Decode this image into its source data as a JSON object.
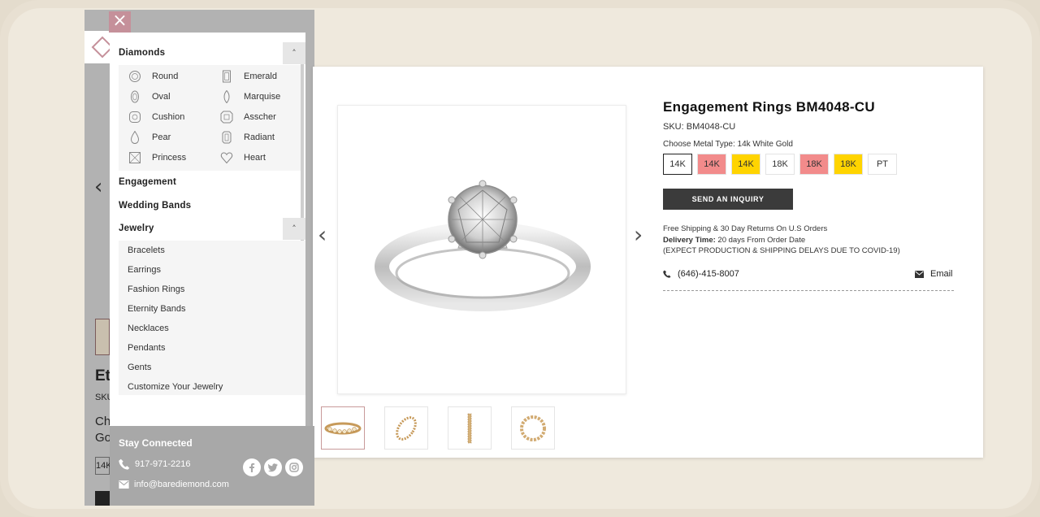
{
  "menu": {
    "close_label": "×",
    "diamonds": {
      "label": "Diamonds",
      "collapse_glyph": "˄",
      "shapes": [
        {
          "label": "Round",
          "icon": "round-diamond-icon"
        },
        {
          "label": "Emerald",
          "icon": "emerald-diamond-icon"
        },
        {
          "label": "Oval",
          "icon": "oval-diamond-icon"
        },
        {
          "label": "Marquise",
          "icon": "marquise-diamond-icon"
        },
        {
          "label": "Cushion",
          "icon": "cushion-diamond-icon"
        },
        {
          "label": "Asscher",
          "icon": "asscher-diamond-icon"
        },
        {
          "label": "Pear",
          "icon": "pear-diamond-icon"
        },
        {
          "label": "Radiant",
          "icon": "radiant-diamond-icon"
        },
        {
          "label": "Princess",
          "icon": "princess-diamond-icon"
        },
        {
          "label": "Heart",
          "icon": "heart-diamond-icon"
        }
      ]
    },
    "engagement": "Engagement",
    "wedding_bands": "Wedding Bands",
    "jewelry": {
      "label": "Jewelry",
      "collapse_glyph": "˄",
      "items": [
        "Bracelets",
        "Earrings",
        "Fashion Rings",
        "Eternity Bands",
        "Necklaces",
        "Pendants",
        "Gents",
        "Customize Your Jewelry"
      ]
    },
    "stay_connected": {
      "title": "Stay Connected",
      "phone": "917-971-2216",
      "email": "info@barediemond.com",
      "social": [
        "facebook-icon",
        "twitter-icon",
        "instagram-icon"
      ]
    }
  },
  "background_page": {
    "text_lines": [
      "Et",
      "SKU",
      "Ch",
      "Go",
      "14K"
    ]
  },
  "product": {
    "title": "Engagement Rings BM4048-CU",
    "sku": "SKU: BM4048-CU",
    "metal_label": "Choose Metal Type: 14k White Gold",
    "metals": [
      {
        "label": "14K",
        "color": "#ffffff",
        "selected": true
      },
      {
        "label": "14K",
        "color": "#f28b8b",
        "selected": false
      },
      {
        "label": "14K",
        "color": "#ffd400",
        "selected": false
      },
      {
        "label": "18K",
        "color": "#ffffff",
        "selected": false
      },
      {
        "label": "18K",
        "color": "#f28b8b",
        "selected": false
      },
      {
        "label": "18K",
        "color": "#ffd400",
        "selected": false
      },
      {
        "label": "PT",
        "color": "#ffffff",
        "selected": false
      }
    ],
    "inquiry_label": "SEND AN INQUIRY",
    "shipping": "Free Shipping & 30 Day Returns On U.S Orders",
    "delivery_label": "Delivery Time:",
    "delivery_value": " 20 days From Order Date",
    "covid_note": "(EXPECT PRODUCTION & SHIPPING DELAYS DUE TO COVID-19)",
    "phone": "(646)-415-8007",
    "email_label": "Email",
    "prev_glyph": "‹",
    "next_glyph": "›",
    "thumbnails": 4
  },
  "colors": {
    "accent_pink": "#c5909a",
    "button_dark": "#3b3b3b",
    "menu_gray": "#a8a8a8"
  }
}
